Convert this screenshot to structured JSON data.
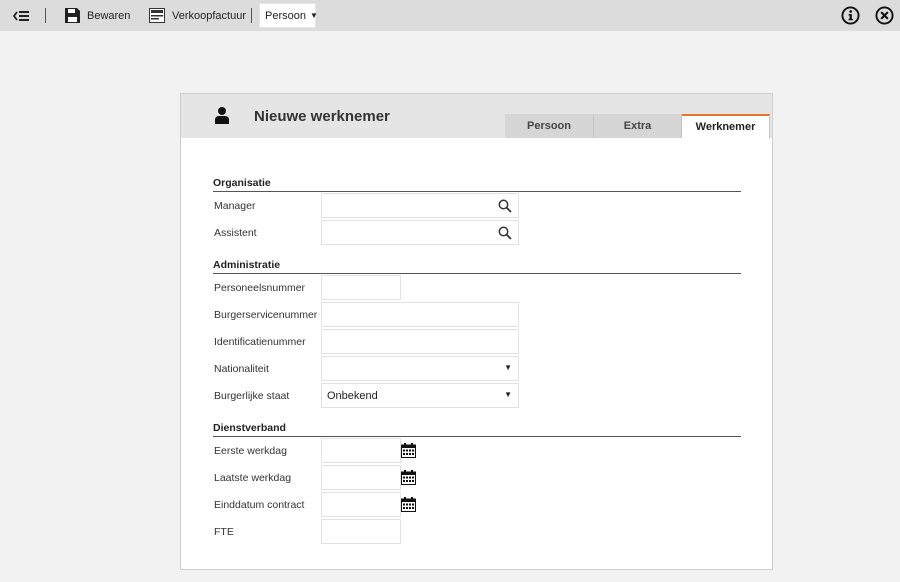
{
  "toolbar": {
    "back_icon": "collapse-menu-icon",
    "save_label": "Bewaren",
    "invoice_label": "Verkoopfactuur",
    "view_select": "Persoon",
    "info_icon": "info-icon",
    "close_icon": "close-icon"
  },
  "panel": {
    "title": "Nieuwe werknemer",
    "tabs": [
      "Persoon",
      "Extra",
      "Werknemer"
    ],
    "active_tab": "Werknemer"
  },
  "sections": {
    "organisatie": "Organisatie",
    "administratie": "Administratie",
    "dienstverband": "Dienstverband"
  },
  "fields": {
    "manager": {
      "label": "Manager",
      "value": ""
    },
    "assistent": {
      "label": "Assistent",
      "value": ""
    },
    "personeelsnummer": {
      "label": "Personeelsnummer",
      "value": ""
    },
    "burgerservicenummer": {
      "label": "Burgerservicenummer",
      "value": ""
    },
    "identificatienummer": {
      "label": "Identificatienummer",
      "value": ""
    },
    "nationaliteit": {
      "label": "Nationaliteit",
      "value": ""
    },
    "burgerlijke_staat": {
      "label": "Burgerlijke staat",
      "value": "Onbekend"
    },
    "eerste_werkdag": {
      "label": "Eerste werkdag",
      "value": ""
    },
    "laatste_werkdag": {
      "label": "Laatste werkdag",
      "value": ""
    },
    "einddatum_contract": {
      "label": "Einddatum contract",
      "value": ""
    },
    "fte": {
      "label": "FTE",
      "value": ""
    }
  },
  "colors": {
    "accent": "#e8772e",
    "toolbar": "#dcdcdc",
    "header": "#e5e5e5"
  }
}
